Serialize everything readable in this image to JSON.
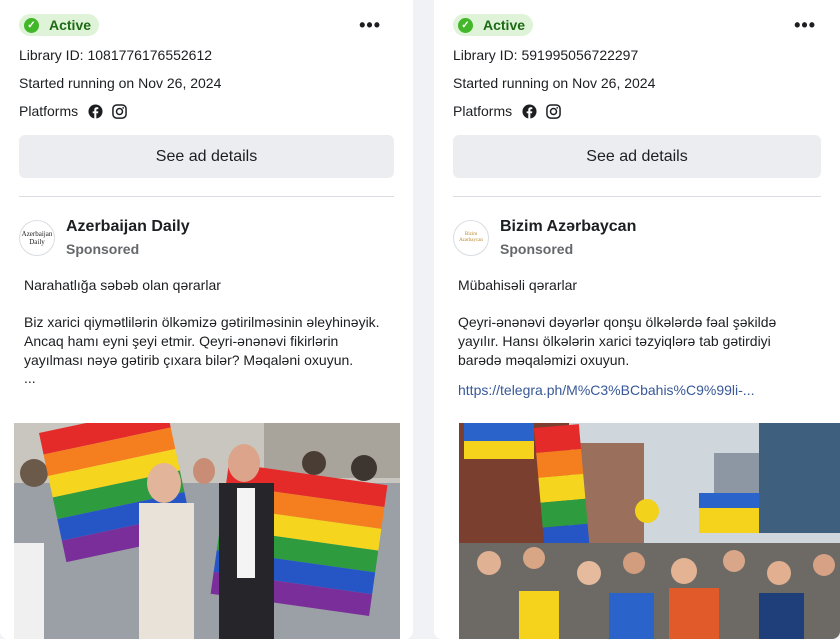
{
  "cards": [
    {
      "status": "Active",
      "library_id": "Library ID: 1081776176552612",
      "started": "Started running on Nov 26, 2024",
      "platforms_label": "Platforms",
      "platform_icons": [
        "facebook-icon",
        "instagram-icon"
      ],
      "details_button": "See ad details",
      "advertiser": {
        "name": "Azerbaijan Daily",
        "sponsored": "Sponsored",
        "logo_text_line1": "Azerbaijan",
        "logo_text_line2": "Daily"
      },
      "headline": "Narahatlığa səbəb olan qərarlar",
      "text": "Biz xarici qiymətlilərin ölkəmizə gətirilməsinin əleyhinəyik. Ancaq hamı eyni şeyi etmir. Qeyri-ənənəvi fikirlərin yayılması nəyə gətirib çıxara bilər? Məqaləni oxuyun.",
      "ellipsis": "...",
      "image": "pride-march-photo"
    },
    {
      "status": "Active",
      "library_id": "Library ID: 591995056722297",
      "started": "Started running on Nov 26, 2024",
      "platforms_label": "Platforms",
      "platform_icons": [
        "facebook-icon",
        "instagram-icon"
      ],
      "details_button": "See ad details",
      "advertiser": {
        "name": "Bizim Azərbaycan",
        "sponsored": "Sponsored",
        "logo_text_line1": "Bizim",
        "logo_text_line2": "Azərbaycan"
      },
      "headline": "Mübahisəli qərarlar",
      "text": "Qeyri-ənənəvi dəyərlər qonşu ölkələrdə fəal şəkildə yayılır. Hansı ölkələrin xarici təzyiqlərə tab gətirdiyi barədə məqaləmizi oxuyun.",
      "link": "https://telegra.ph/M%C3%BCbahis%C9%99li-...",
      "image": "pride-parade-crowd-photo"
    }
  ],
  "colors": {
    "active_bg": "#dff3d8",
    "active_check": "#42b72a",
    "active_text": "#1c6b14",
    "button_bg": "#ebedf0",
    "link": "#385898"
  }
}
